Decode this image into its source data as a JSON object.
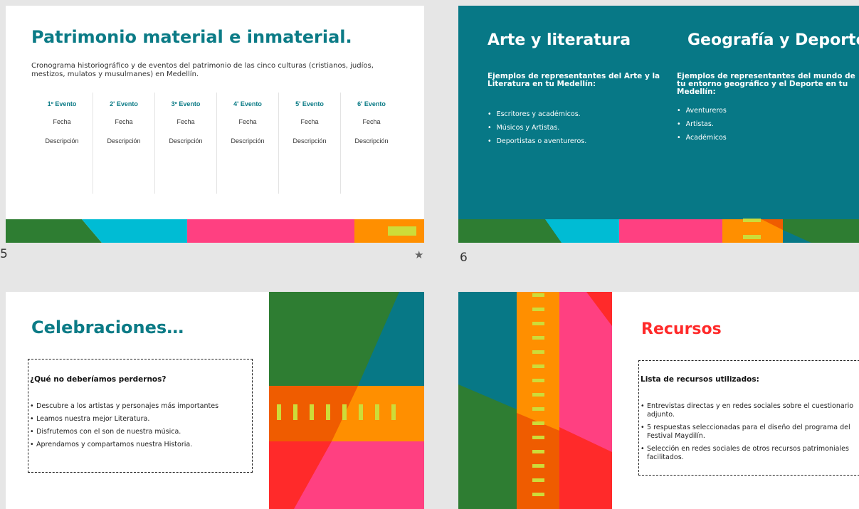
{
  "colors": {
    "teal": "#077886",
    "title_teal": "#0b7b86",
    "green": "#2e7d32",
    "cyan": "#00bcd4",
    "pink": "#ff4081",
    "orange": "#ff8f00",
    "dark_orange": "#ef5c00",
    "yellow": "#cddc39",
    "red": "#ff2a2a"
  },
  "slide5": {
    "number": "5",
    "title": "Patrimonio material e inmaterial.",
    "description": "Cronograma historiográfico y de eventos del patrimonio de las cinco culturas (cristianos, judíos, mestizos, mulatos y musulmanes) en Medellín.",
    "events": [
      {
        "title": "1º Evento",
        "date": "Fecha",
        "desc": "Descripción"
      },
      {
        "title": "2' Evento",
        "date": "Fecha",
        "desc": "Descripción"
      },
      {
        "title": "3º Evento",
        "date": "Fecha",
        "desc": "Descripción"
      },
      {
        "title": "4' Evento",
        "date": "Fecha",
        "desc": "Descripción"
      },
      {
        "title": "5' Evento",
        "date": "Fecha",
        "desc": "Descripción"
      },
      {
        "title": "6' Evento",
        "date": "Fecha",
        "desc": "Descripción"
      }
    ],
    "star_icon": "★"
  },
  "slide6": {
    "number": "6",
    "col1": {
      "title": "Arte y literatura",
      "subtitle": "Ejemplos de representantes del Arte y la Literatura en tu Medellín:",
      "items": [
        "Escritores y académicos.",
        "Músicos y Artistas.",
        "Deportistas o aventureros."
      ]
    },
    "col2": {
      "title": "Geografía y Deporte",
      "subtitle": "Ejemplos de representantes del mundo de tu entorno geográfico y el Deporte en tu Medellín:",
      "items": [
        "Aventureros",
        "Artistas.",
        "Académicos"
      ]
    }
  },
  "slide7": {
    "title": "Celebraciones…",
    "question": "¿Qué no deberíamos perdernos?",
    "items": [
      "Descubre a los artistas y personajes más importantes",
      "Leamos nuestra mejor Literatura.",
      "Disfrutemos con el son de nuestra música.",
      "Aprendamos y compartamos nuestra Historia."
    ]
  },
  "slide8": {
    "title": "Recursos",
    "list_title": "Lista de recursos utilizados:",
    "items": [
      "Entrevistas directas y en redes sociales sobre el cuestionario adjunto.",
      "5 respuestas seleccionadas para el diseño del programa del Festival Maydilín.",
      "Selección en redes sociales de otros recursos patrimoniales facilitados."
    ]
  }
}
